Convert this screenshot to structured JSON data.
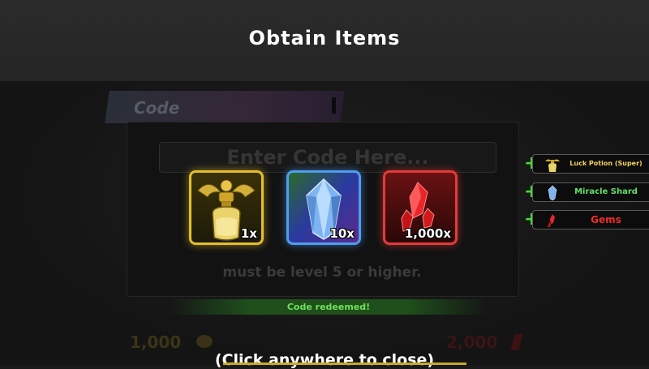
{
  "header": {
    "title": "Obtain Items"
  },
  "code_panel": {
    "tab_label": "Code",
    "input_placeholder": "Enter Code Here...",
    "level_note": "must be level 5 or higher.",
    "status": "Code redeemed!"
  },
  "rewards": [
    {
      "name": "Luck Potion (Super)",
      "icon": "luck-potion-icon",
      "quantity": "1x",
      "rarity_color": "#e4be2b"
    },
    {
      "name": "Miracle Shard",
      "icon": "miracle-shard-icon",
      "quantity": "10x",
      "rarity_color": "#4f9cf0"
    },
    {
      "name": "Gems",
      "icon": "gems-icon",
      "quantity": "1,000x",
      "rarity_color": "#e33a3a"
    }
  ],
  "notifications": [
    {
      "label": "Luck Potion (Super)",
      "color": "#f1d25c"
    },
    {
      "label": "Miracle Shard",
      "color": "#62e06a"
    },
    {
      "label": "Gems",
      "color": "#f02b2b"
    }
  ],
  "stats": {
    "coins": "1,000",
    "gems": "2,000"
  },
  "footer": {
    "close_hint": "(Click anywhere to close)"
  }
}
